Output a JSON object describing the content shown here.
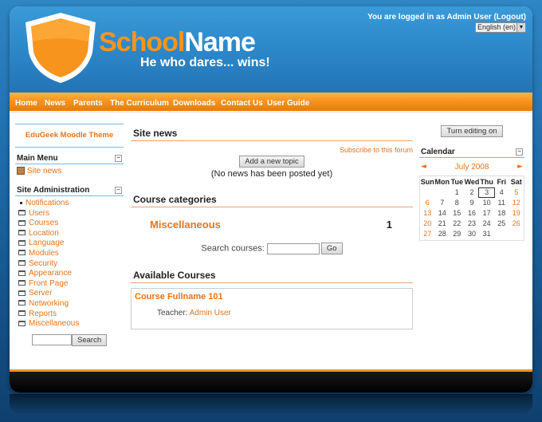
{
  "header": {
    "school_name_part1": "School",
    "school_name_part2": "Name",
    "motto": "He who dares... wins!",
    "login_prefix": "You are logged in as ",
    "login_user": "Admin User",
    "logout_label": "(Logout)",
    "language": "English (en)"
  },
  "nav": {
    "items": [
      "Home",
      "News",
      "Parents",
      "The Curriculum",
      "Downloads",
      "Contact Us",
      "User Guide"
    ]
  },
  "left": {
    "theme_title": "EduGeek Moodle Theme",
    "main_menu_title": "Main Menu",
    "site_news_link": "Site news",
    "site_admin_title": "Site Administration",
    "admin_items": [
      "Notifications",
      "Users",
      "Courses",
      "Location",
      "Language",
      "Modules",
      "Security",
      "Appearance",
      "Front Page",
      "Server",
      "Networking",
      "Reports",
      "Miscellaneous"
    ],
    "search_button": "Search"
  },
  "main": {
    "site_news_heading": "Site news",
    "subscribe_link": "Subscribe to this forum",
    "add_topic_button": "Add a new topic",
    "no_news_text": "(No news has been posted yet)",
    "course_categories_heading": "Course categories",
    "category_name": "Miscellaneous",
    "category_count": "1",
    "search_courses_label": "Search courses:",
    "go_button": "Go",
    "available_courses_heading": "Available Courses",
    "course_title": "Course Fullname 101",
    "teacher_label": "Teacher:",
    "teacher_name": "Admin User"
  },
  "right": {
    "turn_editing_button": "Turn editing on",
    "calendar_title": "Calendar",
    "prev_arrow": "◄",
    "next_arrow": "►",
    "month": "July 2008",
    "day_headers": [
      "Sun",
      "Mon",
      "Tue",
      "Wed",
      "Thu",
      "Fri",
      "Sat"
    ],
    "weeks": [
      [
        "",
        "",
        "1",
        "2",
        "3",
        "4",
        "5"
      ],
      [
        "6",
        "7",
        "8",
        "9",
        "10",
        "11",
        "12"
      ],
      [
        "13",
        "14",
        "15",
        "16",
        "17",
        "18",
        "19"
      ],
      [
        "20",
        "21",
        "22",
        "23",
        "24",
        "25",
        "26"
      ],
      [
        "27",
        "28",
        "29",
        "30",
        "31",
        "",
        ""
      ]
    ],
    "today": "3"
  },
  "colors": {
    "accent_orange": "#f7941d",
    "link_orange": "#e8741b",
    "header_blue": "#2a84c6"
  }
}
